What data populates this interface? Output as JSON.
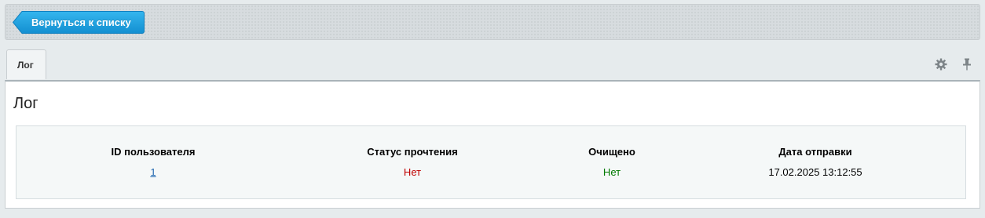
{
  "toolbar": {
    "back_label": "Вернуться к списку"
  },
  "tabs": [
    {
      "label": "Лог"
    }
  ],
  "panel": {
    "title": "Лог"
  },
  "table": {
    "headers": [
      "ID пользователя",
      "Статус прочтения",
      "Очищено",
      "Дата отправки"
    ],
    "row": {
      "user_id": "1",
      "read_status": "Нет",
      "cleared": "Нет",
      "sent_date": "17.02.2025 13:12:55"
    }
  },
  "icons": {
    "settings": "gear-icon",
    "pin": "pin-icon"
  },
  "colors": {
    "back_button": "#20a3e0",
    "link": "#2067b0",
    "status_no_read": "#c00000",
    "status_no_cleared": "#007a00"
  }
}
